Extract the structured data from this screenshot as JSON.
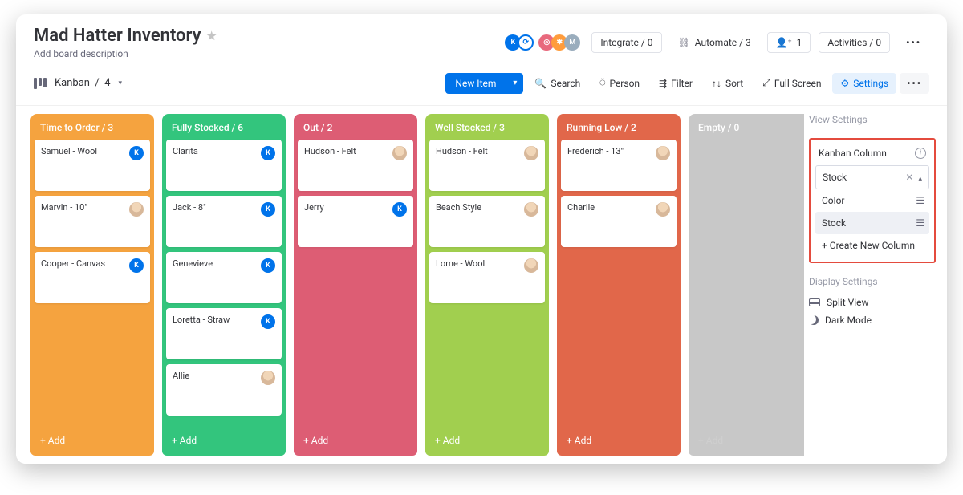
{
  "header": {
    "title": "Mad Hatter Inventory",
    "desc": "Add board description",
    "integrate_label": "Integrate / 0",
    "automate_label": "Automate / 3",
    "members_label": "1",
    "activities_label": "Activities / 0"
  },
  "toolbar": {
    "view_label": "Kanban",
    "view_count": "4",
    "new_item": "New Item",
    "search": "Search",
    "person": "Person",
    "filter": "Filter",
    "sort": "Sort",
    "fullscreen": "Full Screen",
    "settings": "Settings"
  },
  "columns": [
    {
      "title": "Time to Order / 3",
      "color": "orange",
      "add": "+ Add",
      "cards": [
        {
          "t": "Samuel - Wool",
          "chip": "k"
        },
        {
          "t": "Marvin - 10\"",
          "chip": "face"
        },
        {
          "t": "Cooper - Canvas",
          "chip": "k"
        }
      ]
    },
    {
      "title": "Fully Stocked / 6",
      "color": "green",
      "add": "+ Add",
      "cards": [
        {
          "t": "Clarita",
          "chip": "k"
        },
        {
          "t": "Jack - 8\"",
          "chip": "k"
        },
        {
          "t": "Genevieve",
          "chip": "k"
        },
        {
          "t": "Loretta - Straw",
          "chip": "k"
        },
        {
          "t": "Allie",
          "chip": "face"
        }
      ]
    },
    {
      "title": "Out / 2",
      "color": "pink",
      "add": "+ Add",
      "cards": [
        {
          "t": "Hudson - Felt",
          "chip": "face"
        },
        {
          "t": "Jerry",
          "chip": "k"
        }
      ]
    },
    {
      "title": "Well Stocked / 3",
      "color": "lime",
      "add": "+ Add",
      "cards": [
        {
          "t": "Hudson - Felt",
          "chip": "face"
        },
        {
          "t": "Beach Style",
          "chip": "face"
        },
        {
          "t": "Lorne - Wool",
          "chip": "face"
        }
      ]
    },
    {
      "title": "Running Low / 2",
      "color": "red",
      "add": "+ Add",
      "cards": [
        {
          "t": "Frederich - 13\"",
          "chip": "face"
        },
        {
          "t": "Charlie",
          "chip": "face"
        }
      ]
    },
    {
      "title": "Empty / 0",
      "color": "gray",
      "add": "+ Add",
      "cards": []
    }
  ],
  "settings": {
    "view_settings": "View Settings",
    "kanban_column": "Kanban Column",
    "selected": "Stock",
    "options": [
      "Color",
      "Stock"
    ],
    "create_new": "+ Create New Column",
    "display": "Display Settings",
    "split": "Split View",
    "dark": "Dark Mode"
  }
}
